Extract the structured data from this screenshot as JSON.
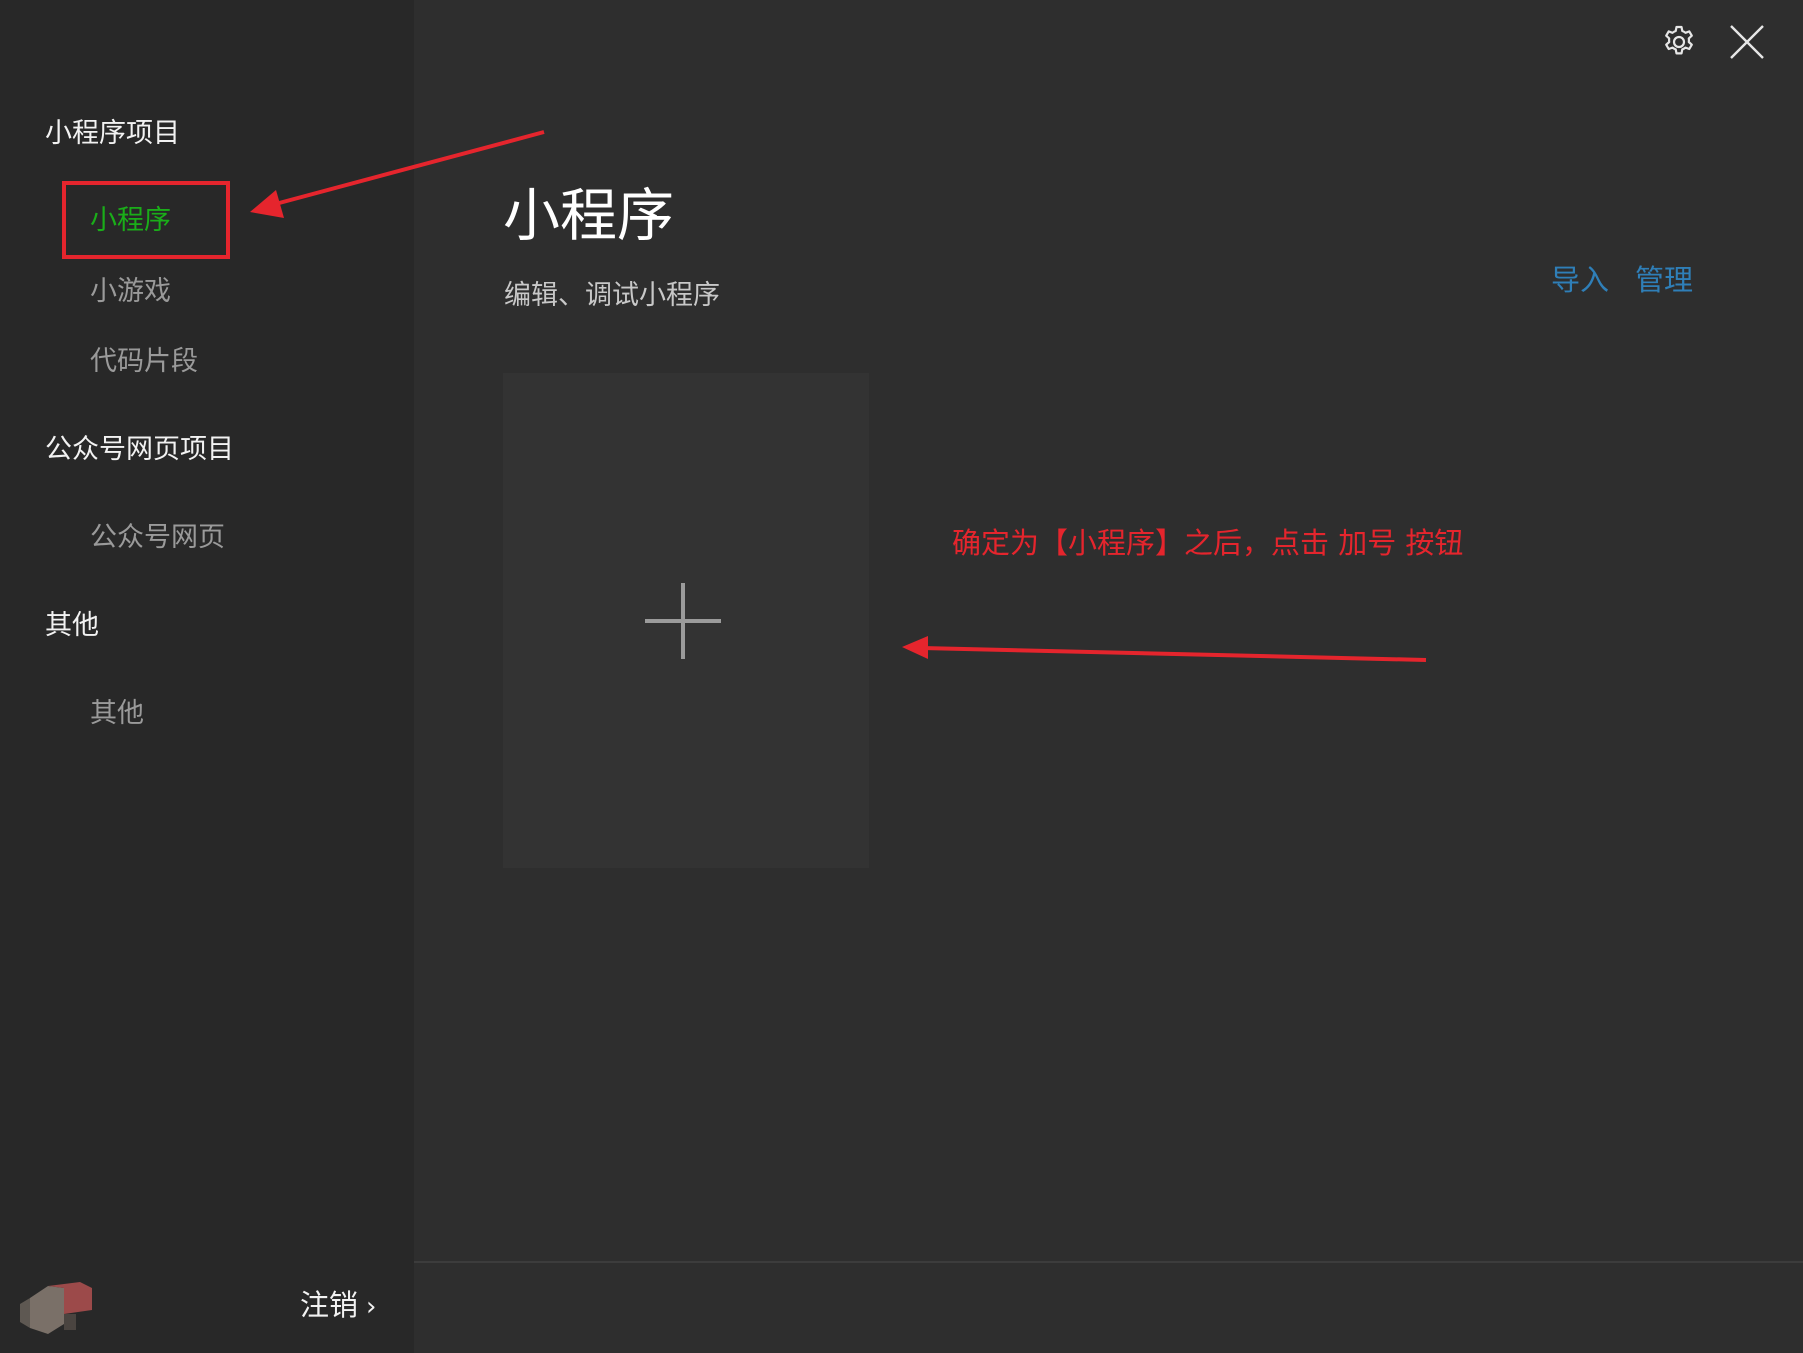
{
  "sidebar": {
    "groups": [
      {
        "title": "小程序项目",
        "items": [
          "小程序",
          "小游戏",
          "代码片段"
        ]
      },
      {
        "title": "公众号网页项目",
        "items": [
          "公众号网页"
        ]
      },
      {
        "title": "其他",
        "items": [
          "其他"
        ]
      }
    ],
    "active_item": "小程序",
    "logout_label": "注销"
  },
  "header": {
    "icons": [
      "gear-icon",
      "close-icon"
    ]
  },
  "main": {
    "title": "小程序",
    "subtitle": "编辑、调试小程序",
    "actions": {
      "import": "导入",
      "manage": "管理"
    },
    "add_card_icon": "plus-icon"
  },
  "annotation": {
    "text": "确定为【小程序】之后，点击 加号 按钮",
    "color": "#e5252d"
  },
  "colors": {
    "active": "#1aad19",
    "link": "#2f7fb8",
    "annotation_red": "#e5252d",
    "background": "#2e2e2e",
    "sidebar": "#282828"
  }
}
